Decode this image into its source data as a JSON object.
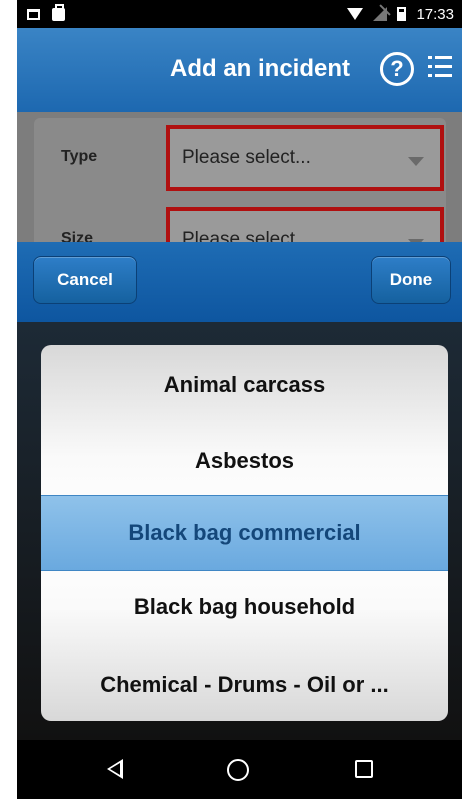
{
  "status_bar": {
    "time": "17:33",
    "icons": [
      "screenshot-icon",
      "bag-notification-icon",
      "wifi-icon",
      "no-signal-icon",
      "battery-charging-icon"
    ]
  },
  "header": {
    "title": "Add an incident",
    "help_icon_glyph": "?",
    "icons": [
      "help-icon",
      "menu-icon"
    ],
    "color": "#2a77bd"
  },
  "form": {
    "type_label": "Type",
    "type_value": "Please select...",
    "size_label": "Size",
    "size_value": "Please select..."
  },
  "picker": {
    "cancel_label": "Cancel",
    "done_label": "Done",
    "options": [
      "Animal carcass",
      "Asbestos",
      "Black bag commercial",
      "Black bag household",
      "Chemical - Drums - Oil or ..."
    ],
    "selected_index": 2,
    "selected_color": "#7ab4e4"
  },
  "nav_bar": {
    "icons": [
      "back-icon",
      "home-icon",
      "recents-icon"
    ]
  }
}
